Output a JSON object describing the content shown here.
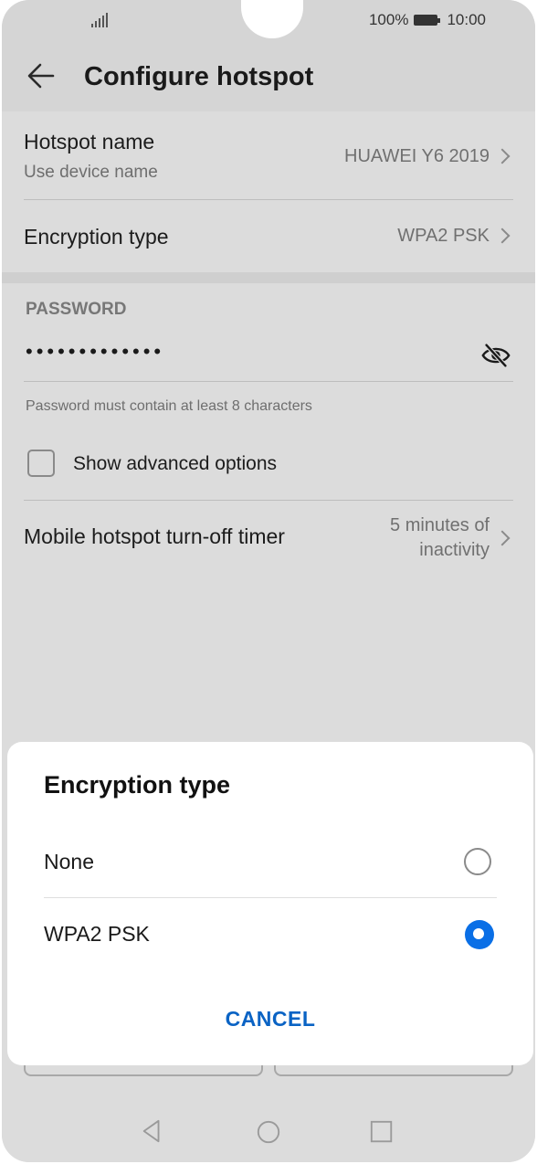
{
  "status_bar": {
    "battery_text": "100%",
    "time": "10:00"
  },
  "app_bar": {
    "title": "Configure hotspot"
  },
  "settings": {
    "hotspot_name": {
      "label": "Hotspot name",
      "sublabel": "Use device name",
      "value": "HUAWEI Y6 2019"
    },
    "encryption": {
      "label": "Encryption type",
      "value": "WPA2 PSK"
    },
    "password": {
      "section_header": "PASSWORD",
      "masked_value": "•••••••••••••",
      "hint": "Password must contain at least 8 characters"
    },
    "advanced": {
      "label": "Show advanced options",
      "checked": false
    },
    "timer": {
      "label": "Mobile hotspot turn-off timer",
      "value_line1": "5 minutes of",
      "value_line2": "inactivity"
    }
  },
  "dialog": {
    "title": "Encryption type",
    "options": [
      {
        "label": "None",
        "selected": false
      },
      {
        "label": "WPA2 PSK",
        "selected": true
      }
    ],
    "cancel_label": "CANCEL"
  },
  "colors": {
    "accent": "#0a6fe6",
    "cancel": "#0a63c4"
  },
  "icons": [
    "back-arrow-icon",
    "eye-off-icon",
    "chevron-right-icon",
    "nav-back-icon",
    "nav-home-icon",
    "nav-recents-icon",
    "signal-icon",
    "battery-icon"
  ]
}
